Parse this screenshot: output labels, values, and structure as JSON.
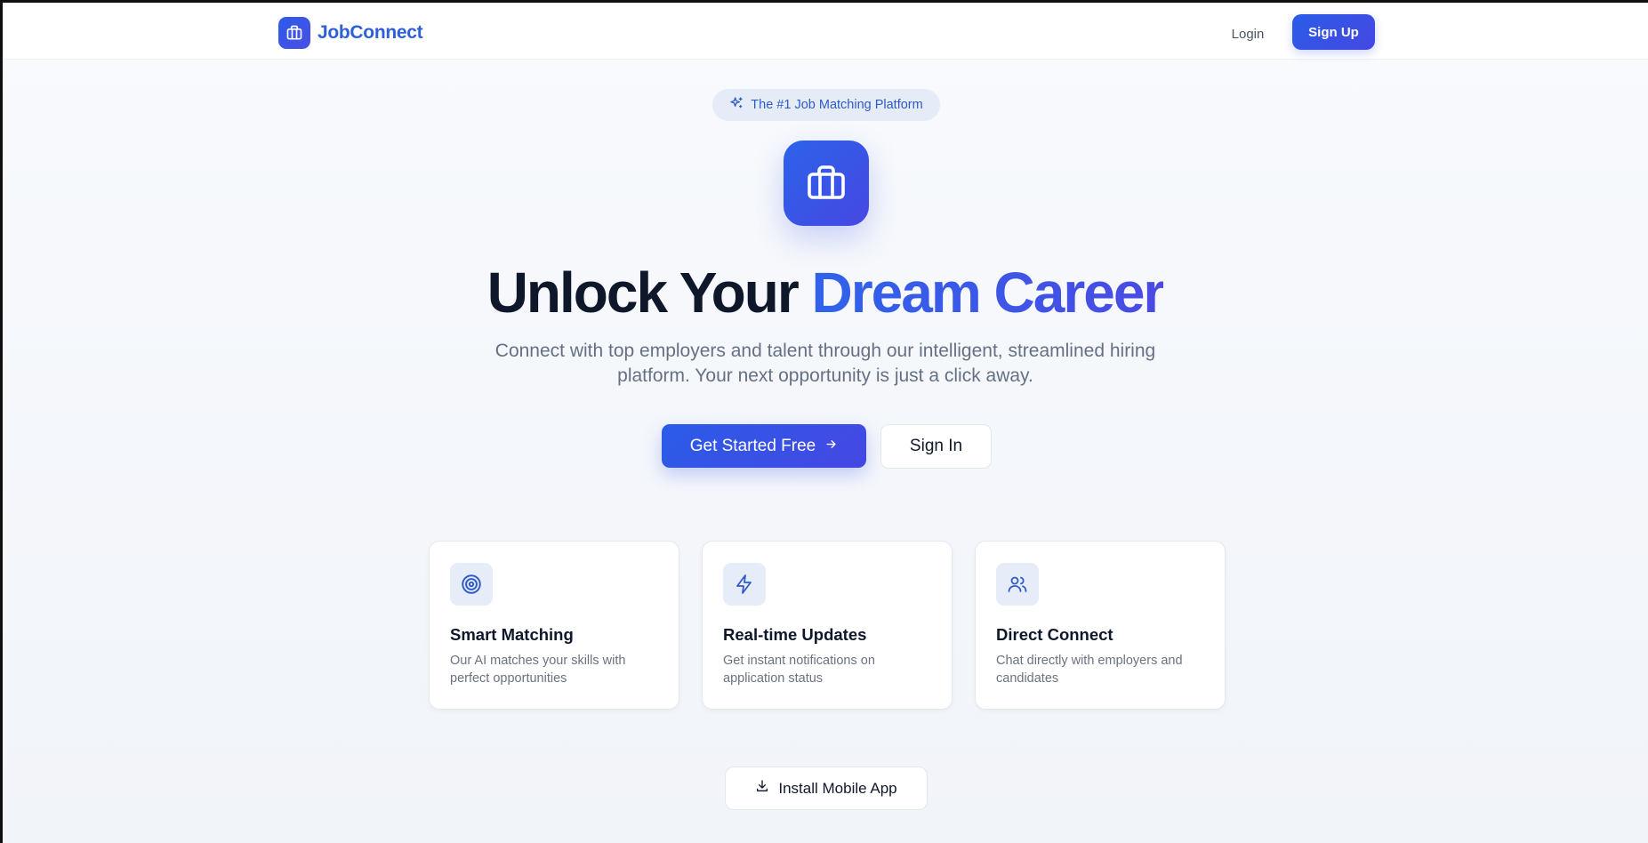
{
  "colors": {
    "brand": "#2f5fd6",
    "accent_gradient_start": "#2b5ce8",
    "accent_gradient_end": "#4547e3",
    "heading": "#0f172a",
    "muted": "#667085",
    "badge_bg": "#e5ecf8",
    "icon_bg": "#e6edf9"
  },
  "header": {
    "logo_icon": "briefcase-icon",
    "brand_name": "JobConnect",
    "login_label": "Login",
    "signup_label": "Sign Up"
  },
  "hero": {
    "badge_icon": "sparkles-icon",
    "badge_text": "The #1 Job Matching Platform",
    "main_icon": "briefcase-icon",
    "headline_part1": "Unlock Your",
    "headline_part2": "Dream Career",
    "subtitle": "Connect with top employers and talent through our intelligent, streamlined hiring platform. Your next opportunity is just a click away.",
    "primary_cta": "Get Started Free",
    "primary_cta_icon": "arrow-right-icon",
    "secondary_cta": "Sign In"
  },
  "features": [
    {
      "icon": "target-icon",
      "title": "Smart Matching",
      "description": "Our AI matches your skills with perfect opportunities"
    },
    {
      "icon": "zap-icon",
      "title": "Real-time Updates",
      "description": "Get instant notifications on application status"
    },
    {
      "icon": "users-icon",
      "title": "Direct Connect",
      "description": "Chat directly with employers and candidates"
    }
  ],
  "install": {
    "icon": "download-icon",
    "label": "Install Mobile App"
  }
}
